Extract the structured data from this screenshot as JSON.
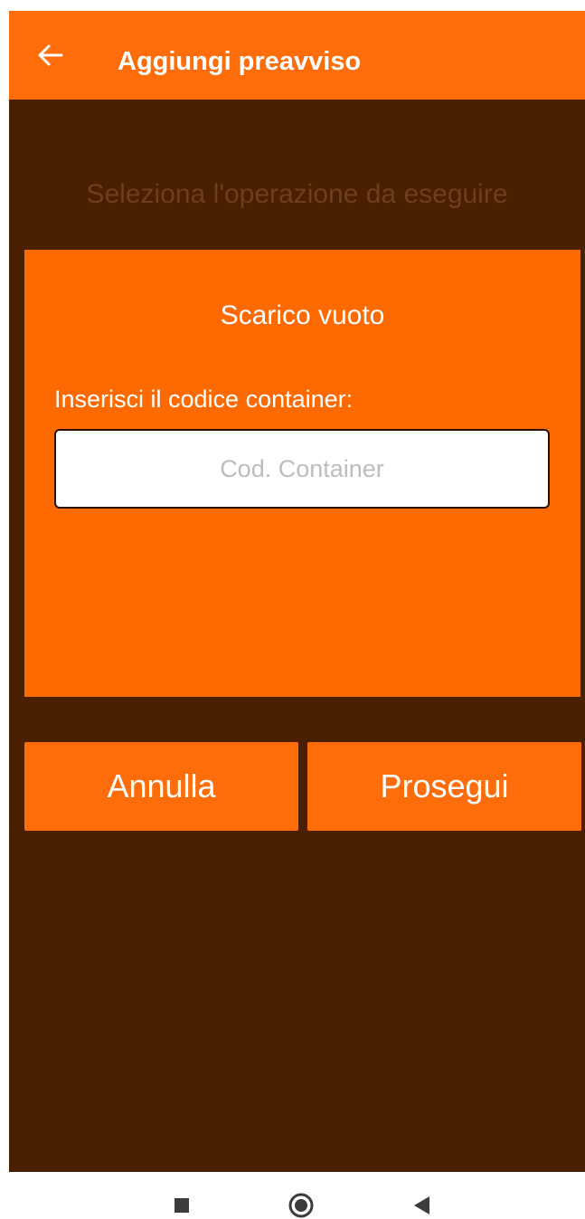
{
  "appbar": {
    "title": "Aggiungi preavviso",
    "back_icon": "arrow-left-icon"
  },
  "subtitle": "Seleziona l'operazione da eseguire",
  "card": {
    "title": "Scarico vuoto",
    "field_label": "Inserisci il codice container:",
    "input_value": "",
    "input_placeholder": "Cod. Container"
  },
  "buttons": {
    "cancel_label": "Annulla",
    "continue_label": "Prosegui"
  },
  "navbar": {
    "icons": [
      "square-recents-icon",
      "circle-home-icon",
      "triangle-back-icon"
    ]
  },
  "colors": {
    "accent": "#ff6d0a",
    "background": "#4a2000",
    "subtitle_text": "#6e3f1c"
  }
}
